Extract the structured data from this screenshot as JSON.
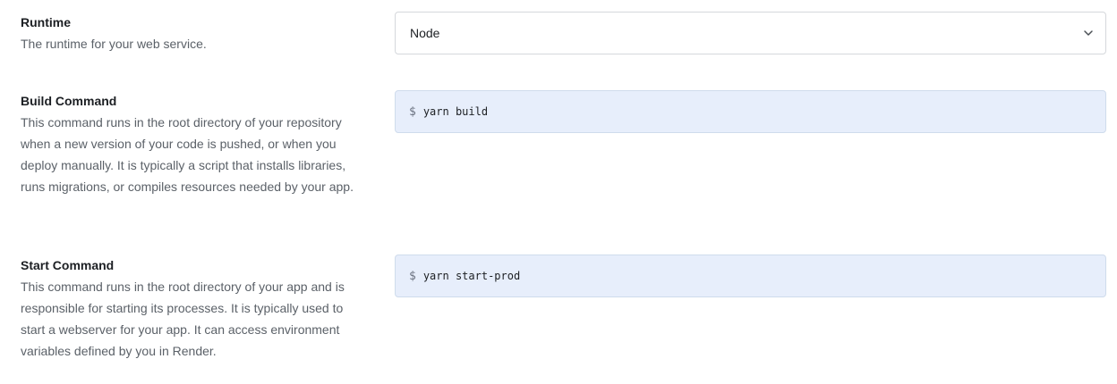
{
  "runtime": {
    "title": "Runtime",
    "description": "The runtime for your web service.",
    "selected_value": "Node",
    "icon": "chevron-down-icon"
  },
  "build_command": {
    "title": "Build Command",
    "description": "This command runs in the root directory of your repository when a new version of your code is pushed, or when you deploy manually. It is typically a script that installs libraries, runs migrations, or compiles resources needed by your app.",
    "prompt": "$",
    "value": "yarn build"
  },
  "start_command": {
    "title": "Start Command",
    "description": "This command runs in the root directory of your app and is responsible for starting its processes. It is typically used to start a webserver for your app. It can access environment variables defined by you in Render.",
    "prompt": "$",
    "value": "yarn start-prod"
  },
  "colors": {
    "command_background": "#e7eefb",
    "command_border": "#cfdcec",
    "select_border": "#d5d8dc",
    "description_text": "#5b6168"
  }
}
